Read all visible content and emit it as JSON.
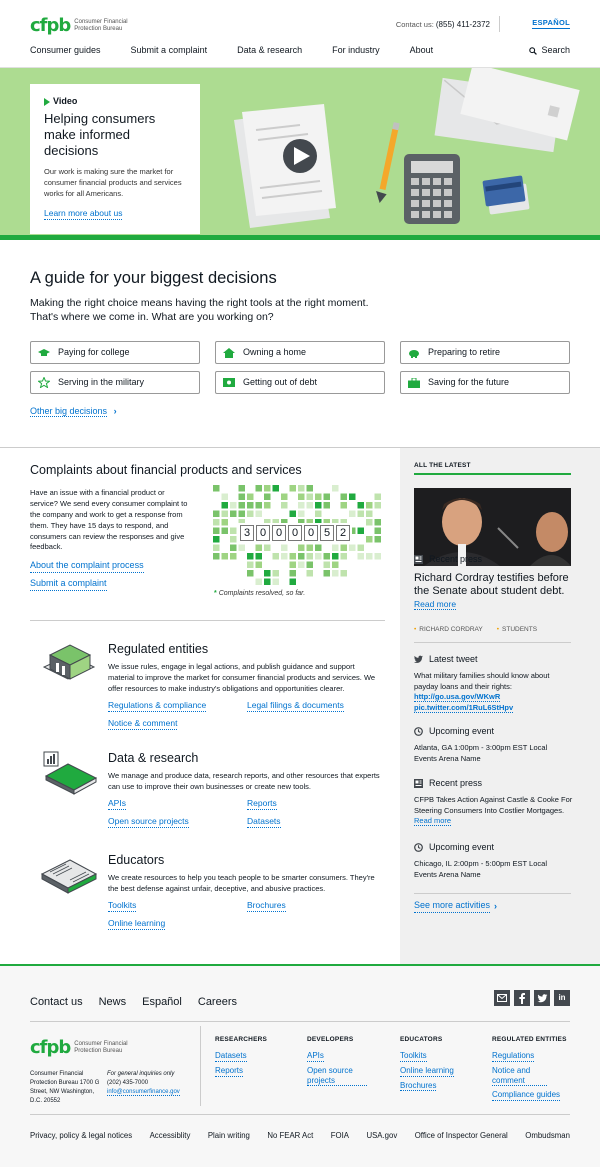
{
  "header": {
    "logo_mark": "cfpb",
    "logo_sub": "Consumer Financial Protection Bureau",
    "contact_label": "Contact us:",
    "contact_phone": "(855) 411-2372",
    "espanol": "ESPAÑOL",
    "nav": [
      "Consumer guides",
      "Submit a complaint",
      "Data & research",
      "For industry",
      "About"
    ],
    "search": "Search"
  },
  "hero": {
    "kicker": "Video",
    "title": "Helping consumers make informed decisions",
    "body": "Our work is making sure the market for consumer financial products and services works for all Americans.",
    "link": "Learn more about us"
  },
  "guide": {
    "title": "A guide for your biggest decisions",
    "lead": "Making the right choice means having the right tools at the right moment. That's where we come in. What are you working on?",
    "buttons": [
      {
        "label": "Paying for college",
        "icon": "graduation-cap-icon"
      },
      {
        "label": "Owning a home",
        "icon": "house-icon"
      },
      {
        "label": "Preparing to retire",
        "icon": "piggy-bank-icon"
      },
      {
        "label": "Serving in the military",
        "icon": "star-icon"
      },
      {
        "label": "Getting out of debt",
        "icon": "dollar-bill-icon"
      },
      {
        "label": "Saving for the future",
        "icon": "briefcase-icon"
      }
    ],
    "other": "Other big decisions"
  },
  "complaints": {
    "title": "Complaints about financial products and services",
    "body": "Have an issue with a financial product or service? We send every consumer complaint to the company and work to get a response from them. They have 15 days to respond, and consumers can review the responses and give feedback.",
    "link1": "About the complaint process",
    "link2": "Submit a complaint",
    "digits": [
      "3",
      "0",
      "0",
      "0",
      "0",
      "5",
      "2"
    ],
    "resolved": "Complaints resolved, so far."
  },
  "blocks": [
    {
      "title": "Regulated entities",
      "body": "We issue rules, engage in legal actions, and publish guidance and support material to improve the market for consumer financial products and services. We offer resources to make industry's obligations and opportunities clearer.",
      "links": [
        "Regulations & compliance",
        "Legal filings & documents",
        "Notice & comment"
      ]
    },
    {
      "title": "Data & research",
      "body": "We manage and produce data, research reports, and other resources that experts can use to improve their own businesses or create new tools.",
      "links": [
        "APIs",
        "Reports",
        "Open source projects",
        "Datasets"
      ]
    },
    {
      "title": "Educators",
      "body": "We create resources to help you teach people to be smarter consumers. They're the best defense against unfair, deceptive, and abusive practices.",
      "links": [
        "Toolkits",
        "Brochures",
        "Online learning"
      ]
    }
  ],
  "latest": {
    "heading": "ALL THE LATEST",
    "press1_label": "Recent press",
    "press1_title": "Richard Cordray testifies before the Senate about student debt.",
    "read_more": "Read more",
    "tags": [
      "RICHARD CORDRAY",
      "STUDENTS"
    ],
    "tweet_label": "Latest tweet",
    "tweet_text": "What military families should know about payday loans and their rights:",
    "tweet_link": "http://go.usa.gov/WKwR pic.twitter.com/1RuL6StHpv",
    "event1_label": "Upcoming event",
    "event1_text": "Atlanta, GA 1:00pm - 3:00pm EST Local Events Arena Name",
    "press2_label": "Recent press",
    "press2_text": "CFPB Takes Action Against Castle & Cooke For Steering Consumers Into Costlier Mortgages.",
    "event2_label": "Upcoming event",
    "event2_text": "Chicago, IL 2:00pm - 5:00pm EST Local Events Arena Name",
    "see_more": "See more activities"
  },
  "footer": {
    "nav": [
      "Contact us",
      "News",
      "Español",
      "Careers"
    ],
    "address": "Consumer Financial Protection Bureau 1700 G Street, NW Washington, D.C. 20552",
    "inquiries": "For general inquiries only",
    "phone": "(202) 435-7000",
    "email": "info@consumerfinance.gov",
    "columns": [
      {
        "title": "RESEARCHERS",
        "links": [
          "Datasets",
          "Reports"
        ]
      },
      {
        "title": "DEVELOPERS",
        "links": [
          "APIs",
          "Open source projects"
        ]
      },
      {
        "title": "EDUCATORS",
        "links": [
          "Toolkits",
          "Online learning",
          "Brochures"
        ]
      },
      {
        "title": "REGULATED ENTITIES",
        "links": [
          "Regulations",
          "Notice and comment",
          "Compliance guides"
        ]
      }
    ],
    "legal": [
      "Privacy, policy & legal notices",
      "Accessiblity",
      "Plain writing",
      "No FEAR Act",
      "FOIA",
      "USA.gov",
      "Office of Inspector General",
      "Ombudsman"
    ]
  },
  "colors": {
    "green": "#20aa3f",
    "light_green": "#addc91",
    "link": "#0072ce"
  }
}
